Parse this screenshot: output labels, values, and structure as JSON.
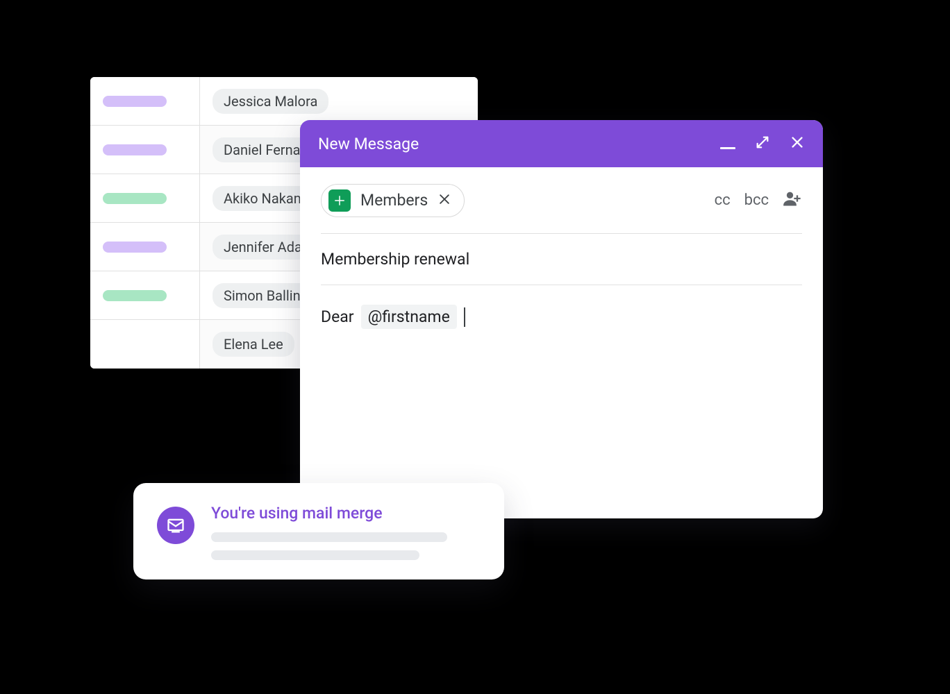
{
  "sheet": {
    "rows": [
      {
        "color": "purple",
        "name": "Jessica Malora"
      },
      {
        "color": "purple",
        "name": "Daniel Fernandez"
      },
      {
        "color": "green",
        "name": "Akiko Nakamura"
      },
      {
        "color": "purple",
        "name": "Jennifer Adams"
      },
      {
        "color": "green",
        "name": "Simon Ballinger"
      },
      {
        "color": "",
        "name": "Elena Lee"
      }
    ]
  },
  "compose": {
    "title": "New Message",
    "recipient_chip": "Members",
    "cc_label": "cc",
    "bcc_label": "bcc",
    "subject": "Membership renewal",
    "body_prefix": "Dear",
    "merge_token": "@firstname"
  },
  "notification": {
    "title": "You're using mail merge"
  }
}
